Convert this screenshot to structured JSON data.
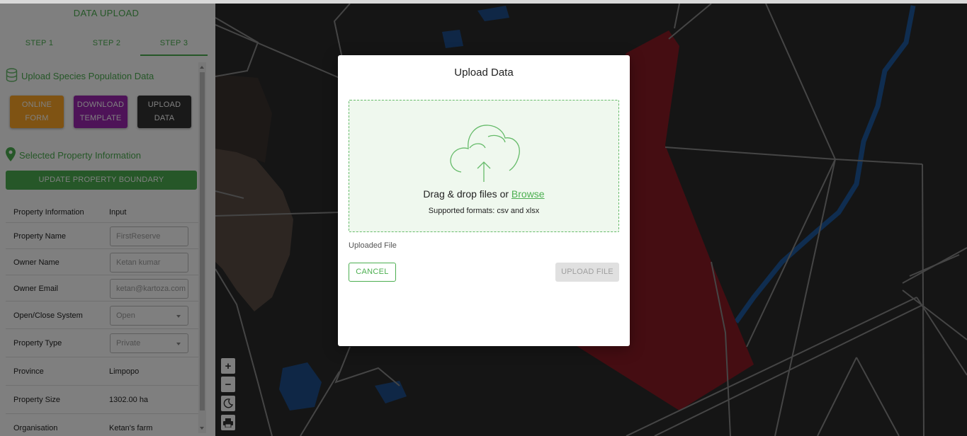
{
  "sidebar": {
    "title": "DATA UPLOAD",
    "tabs": [
      {
        "label": "STEP 1",
        "active": false
      },
      {
        "label": "STEP 2",
        "active": false
      },
      {
        "label": "STEP 3",
        "active": true
      }
    ],
    "species_heading": "Upload Species Population Data",
    "buttons": {
      "online_form": "ONLINE FORM",
      "download_template": "DOWNLOAD TEMPLATE",
      "upload_data": "UPLOAD DATA"
    },
    "property_heading": "Selected Property Information",
    "update_boundary": "UPDATE PROPERTY BOUNDARY",
    "table": {
      "header": {
        "key": "Property Information",
        "value": "Input"
      },
      "rows": [
        {
          "key": "Property Name",
          "value": "FirstReserve"
        },
        {
          "key": "Owner Name",
          "value": "Ketan kumar"
        },
        {
          "key": "Owner Email",
          "value": "ketan@kartoza.com"
        },
        {
          "key": "Open/Close System",
          "value": "Open"
        },
        {
          "key": "Property Type",
          "value": "Private"
        },
        {
          "key": "Province",
          "value": "Limpopo"
        },
        {
          "key": "Property Size",
          "value": "1302.00 ha"
        },
        {
          "key": "Organisation",
          "value": "Ketan's farm"
        }
      ]
    }
  },
  "map": {
    "controls": {
      "zoom_in": "+",
      "zoom_out": "−"
    },
    "colors": {
      "background": "#2b2b2b",
      "roads": "#8a8a8a",
      "water": "#1565c0",
      "property": "#8b1a24"
    }
  },
  "modal": {
    "title": "Upload Data",
    "drop_text": "Drag & drop files or",
    "browse": "Browse",
    "formats": "Supported formats: csv and xlsx",
    "uploaded_file_label": "Uploaded File",
    "cancel": "CANCEL",
    "upload_file": "UPLOAD FILE"
  },
  "theme": {
    "accent": "#4caf50",
    "orange": "#ffa726",
    "purple": "#9c27b0",
    "dark": "#333333"
  }
}
